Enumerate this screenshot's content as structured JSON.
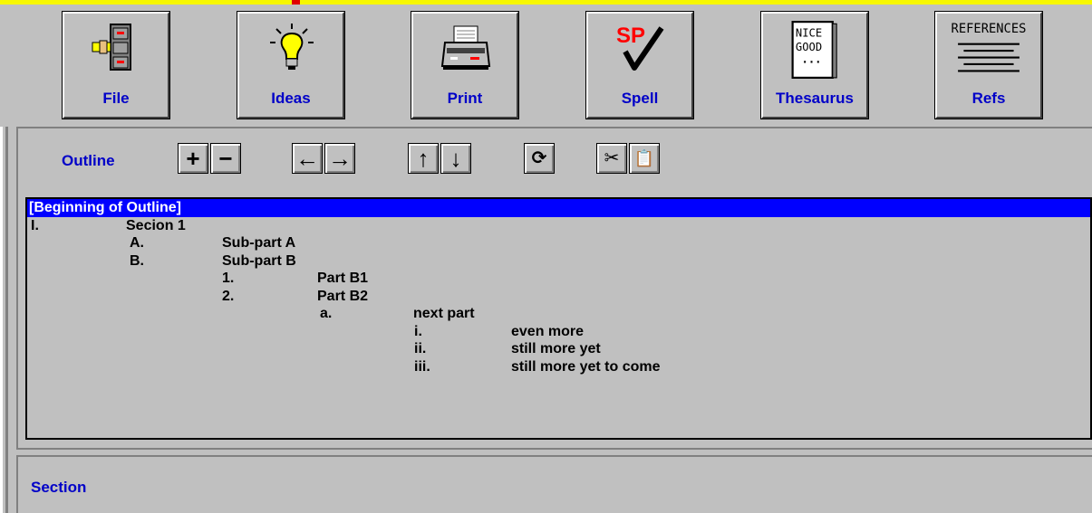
{
  "toolbar": {
    "buttons": [
      {
        "label": "File",
        "icon": "file-cabinet-icon"
      },
      {
        "label": "Ideas",
        "icon": "lightbulb-icon"
      },
      {
        "label": "Print",
        "icon": "printer-icon"
      },
      {
        "label": "Spell",
        "icon": "spellcheck-icon"
      },
      {
        "label": "Thesaurus",
        "icon": "thesaurus-book-icon"
      },
      {
        "label": "Refs",
        "icon": "references-icon"
      }
    ],
    "spell_icon_text": "SP",
    "thesaurus_icon_lines": [
      "NICE",
      "GOOD",
      "..."
    ],
    "refs_icon_text": "REFERENCES"
  },
  "outline": {
    "label": "Outline",
    "tool_buttons": [
      {
        "glyph": "+",
        "icon": "promote-add-icon"
      },
      {
        "glyph": "−",
        "icon": "remove-icon"
      },
      {
        "glyph": "←",
        "icon": "outdent-left-arrow-icon"
      },
      {
        "glyph": "→",
        "icon": "indent-right-arrow-icon"
      },
      {
        "glyph": "↑",
        "icon": "move-up-arrow-icon"
      },
      {
        "glyph": "↓",
        "icon": "move-down-arrow-icon"
      },
      {
        "glyph": "⟳",
        "icon": "refresh-icon"
      },
      {
        "glyph": "✂",
        "icon": "cut-scissors-icon"
      },
      {
        "glyph": "📋",
        "icon": "paste-clipboard-icon"
      }
    ],
    "header": "[Beginning of Outline]",
    "rows": [
      {
        "num": "I.",
        "text": "Secion 1",
        "level": 0
      },
      {
        "num": "A.",
        "text": "Sub-part A",
        "level": 1
      },
      {
        "num": "B.",
        "text": "Sub-part B",
        "level": 1
      },
      {
        "num": "1.",
        "text": "Part B1",
        "level": 2
      },
      {
        "num": "2.",
        "text": "Part B2",
        "level": 2
      },
      {
        "num": "a.",
        "text": "next part",
        "level": 3
      },
      {
        "num": "i.",
        "text": "even more",
        "level": 4
      },
      {
        "num": "ii.",
        "text": "still more yet",
        "level": 4
      },
      {
        "num": "iii.",
        "text": "still more yet to come",
        "level": 4
      }
    ]
  },
  "section": {
    "label": "Section"
  },
  "colors": {
    "accent": "#0000c8",
    "selection": "#0000ff",
    "title_bar": "#f7f700"
  }
}
